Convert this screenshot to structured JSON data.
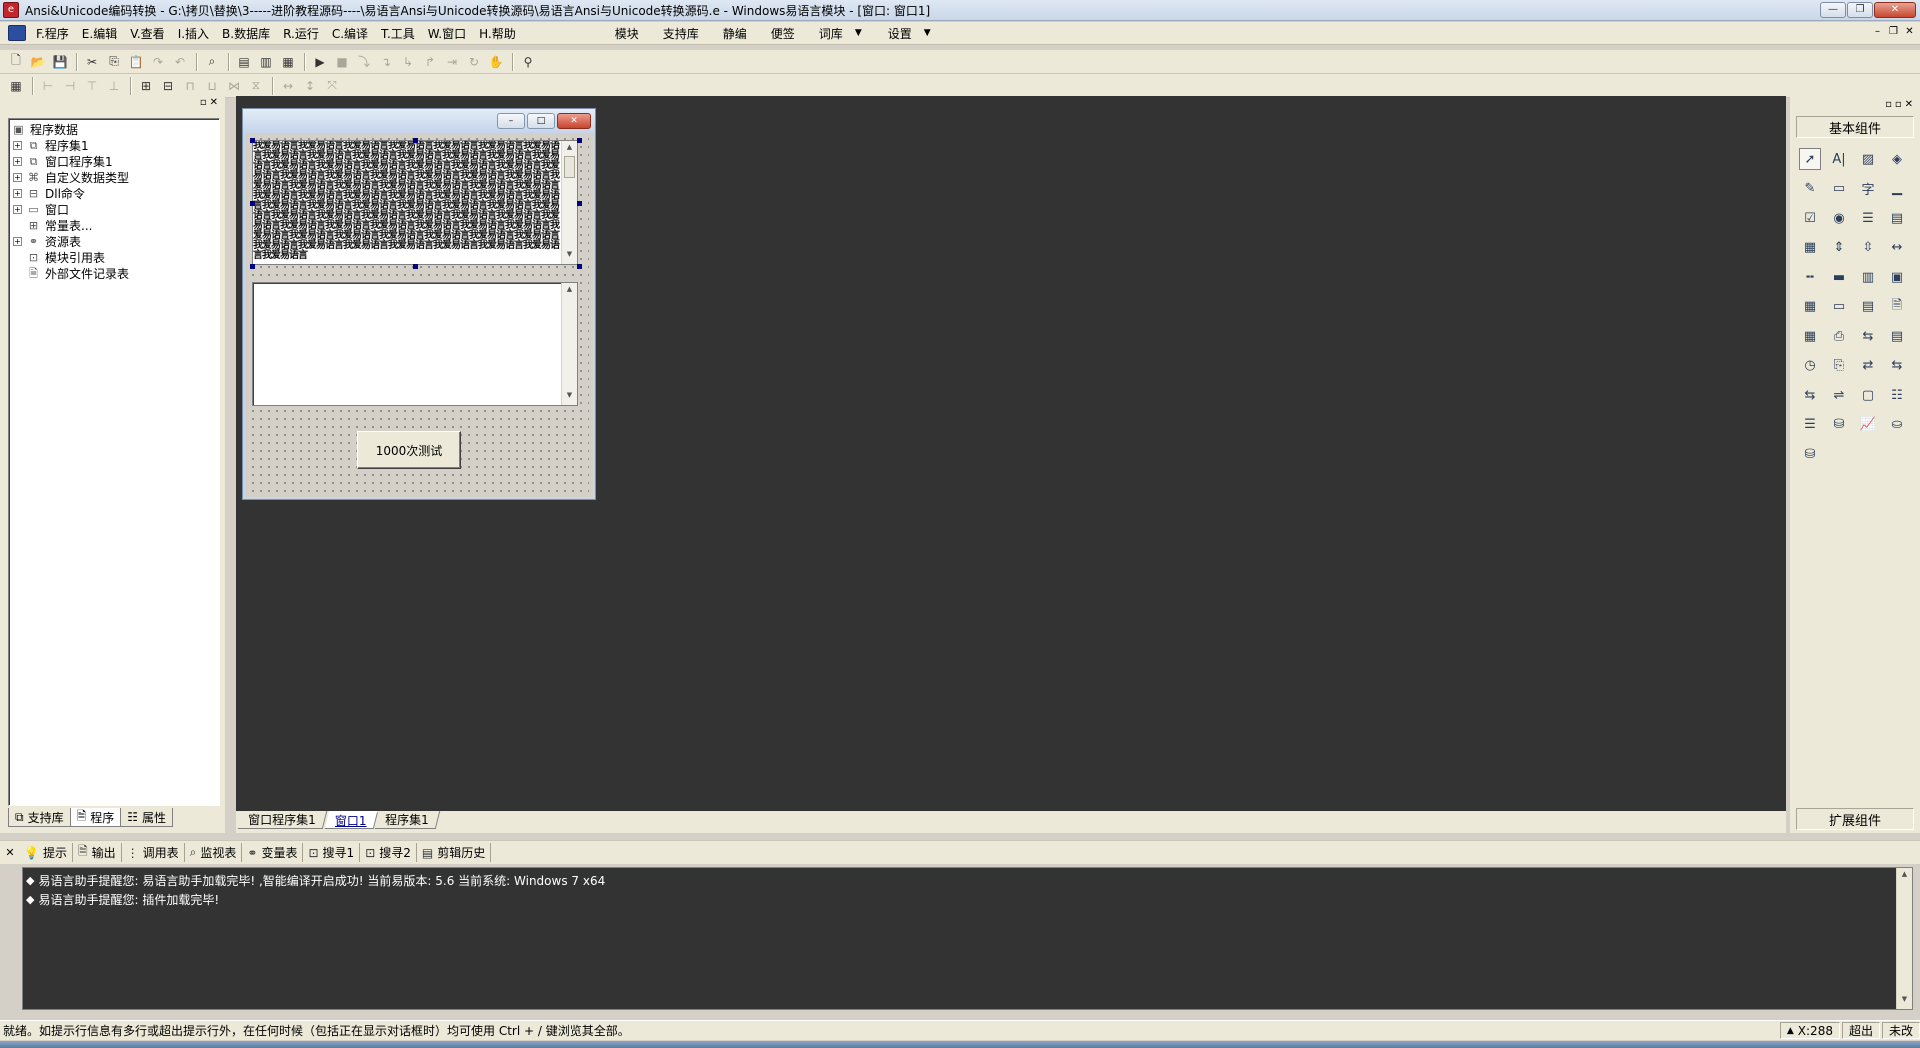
{
  "window": {
    "title": "Ansi&Unicode编码转换 - G:\\拷贝\\替换\\3-----进阶教程源码----\\易语言Ansi与Unicode转换源码\\易语言Ansi与Unicode转换源码.e - Windows易语言模块 - [窗口: 窗口1]",
    "controls": [
      "—",
      "❐",
      "✕"
    ]
  },
  "menubar": {
    "items": [
      "F.程序",
      "E.编辑",
      "V.查看",
      "I.插入",
      "B.数据库",
      "R.运行",
      "C.编译",
      "T.工具",
      "W.窗口",
      "H.帮助"
    ],
    "extra_items": [
      "模块",
      "支持库",
      "静编",
      "便签"
    ],
    "dropdowns": [
      "词库",
      "设置"
    ],
    "mdi_controls": [
      "–",
      "❐",
      "✕"
    ]
  },
  "left_panel": {
    "tree": {
      "root": "程序数据",
      "nodes": [
        {
          "label": "程序集1",
          "expandable": true,
          "icon": "module-icon"
        },
        {
          "label": "窗口程序集1",
          "expandable": true,
          "icon": "module-icon"
        },
        {
          "label": "自定义数据类型",
          "expandable": true,
          "icon": "datatype-icon"
        },
        {
          "label": "Dll命令",
          "expandable": true,
          "icon": "dll-icon"
        },
        {
          "label": "窗口",
          "expandable": true,
          "icon": "window-icon"
        },
        {
          "label": "常量表...",
          "expandable": false,
          "icon": "constant-icon"
        },
        {
          "label": "资源表",
          "expandable": true,
          "icon": "resource-icon"
        },
        {
          "label": "模块引用表",
          "expandable": false,
          "icon": "module-ref-icon"
        },
        {
          "label": "外部文件记录表",
          "expandable": false,
          "icon": "file-record-icon"
        }
      ]
    },
    "tabs": [
      "支持库",
      "程序",
      "属性"
    ]
  },
  "designer": {
    "edit_fill_text": "我爱易语言我爱易语言我爱易语言我爱易语言我爱易语言我爱易语言我爱易语言我爱易语言我爱易语言我爱易语言我爱易语言我爱易语言我爱易语言我爱易语言我爱易语言我爱易语言我爱易语言我爱易语言我爱易语言我爱易语言我爱易语言我爱易语言我爱易语言我爱易语言我爱易语言我爱易语言我爱易语言我爱易语言我爱易语言我爱易语言我爱易语言我爱易语言我爱易语言我爱易语言我爱易语言我爱易语言我爱易语言我爱易语言我爱易语言我爱易语言我爱易语言我爱易语言我爱易语言我爱易语言我爱易语言我爱易语言我爱易语言我爱易语言我爱易语言我爱易语言我爱易语言我爱易语言我爱易语言我爱易语言我爱易语言我爱易语言我爱易语言我爱易语言我爱易语言我爱易语言我爱易语言我爱易语言我爱易语言我爱易语言我爱易语言我爱易语言我爱易语言我爱易语言我爱易语言我爱易语言我爱易语言我爱易语言我爱易语言我爱易语言我爱易语言我爱易语言",
    "button_label": "1000次测试",
    "form_controls": [
      "–",
      "□",
      "✕"
    ],
    "doc_tabs": [
      "窗口程序集1",
      "窗口1",
      "程序集1"
    ],
    "active_doc_tab": "窗口1"
  },
  "right_panel": {
    "header": "基本组件",
    "footer": "扩展组件",
    "components": [
      "pointer-icon",
      "label-icon",
      "picture-icon",
      "shape-icon",
      "edit-icon",
      "groupbox-icon",
      "text-icon",
      "line-icon",
      "checkbox-icon",
      "radio-icon",
      "listbox-icon",
      "combobox-icon",
      "grid-icon",
      "spin-icon",
      "scrollbar-icon",
      "scrollbar-h-icon",
      "slider-icon",
      "progress-icon",
      "tab-icon",
      "image-list-icon",
      "calendar-icon",
      "status-icon",
      "date-icon",
      "doc-icon",
      "table-icon",
      "printer-icon",
      "splitter-icon",
      "media-icon",
      "timer-icon",
      "socket-icon",
      "client-icon",
      "server-icon",
      "port-icon",
      "net-icon",
      "frame-icon",
      "list-view-icon",
      "db-provider-icon",
      "db-source-icon",
      "chart-icon",
      "odbc-icon",
      "odbc-db-icon"
    ]
  },
  "output": {
    "tabs": [
      {
        "label": "提示",
        "icon": "hint-icon"
      },
      {
        "label": "输出",
        "icon": "output-icon"
      },
      {
        "label": "调用表",
        "icon": "call-table-icon"
      },
      {
        "label": "监视表",
        "icon": "watch-icon"
      },
      {
        "label": "变量表",
        "icon": "variable-icon"
      },
      {
        "label": "搜寻1",
        "icon": "search1-icon"
      },
      {
        "label": "搜寻2",
        "icon": "search2-icon"
      },
      {
        "label": "剪辑历史",
        "icon": "clip-history-icon"
      }
    ],
    "lines": [
      {
        "bullet": "◆",
        "text": "易语言助手提醒您: 易语言助手加载完毕!  ,智能编译开启成功!  当前易版本: 5.6  当前系统: Windows 7 x64"
      },
      {
        "bullet": "◆",
        "text": "易语言助手提醒您: 插件加载完毕!"
      }
    ]
  },
  "statusbar": {
    "message": "就绪。如提示行信息有多行或超出提示行外，在任何时候（包括正在显示对话框时）均可使用 Ctrl + / 键浏览其全部。",
    "coord": "X:288",
    "mode": "超出",
    "state": "未改"
  }
}
